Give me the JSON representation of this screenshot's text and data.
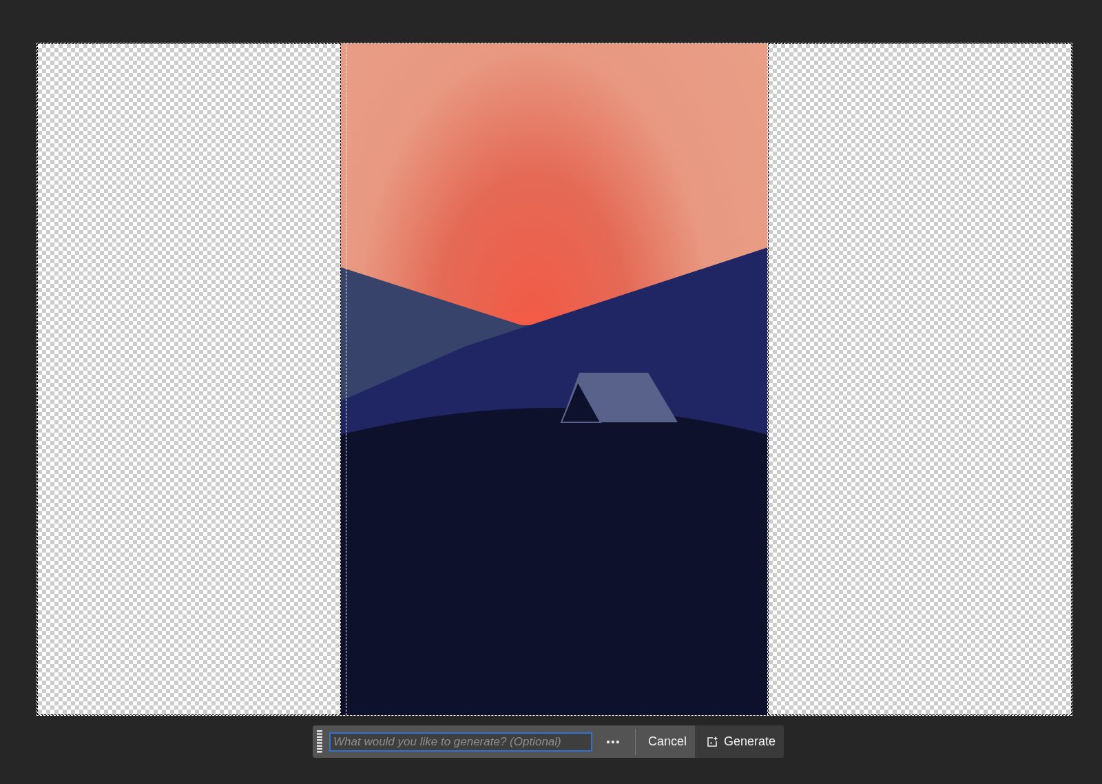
{
  "prompt_bar": {
    "placeholder": "What would you like to generate? (Optional)",
    "buttons": [
      {
        "label": "Cancel",
        "kind": "cancel"
      },
      {
        "label": "Generate",
        "kind": "generate"
      }
    ]
  }
}
